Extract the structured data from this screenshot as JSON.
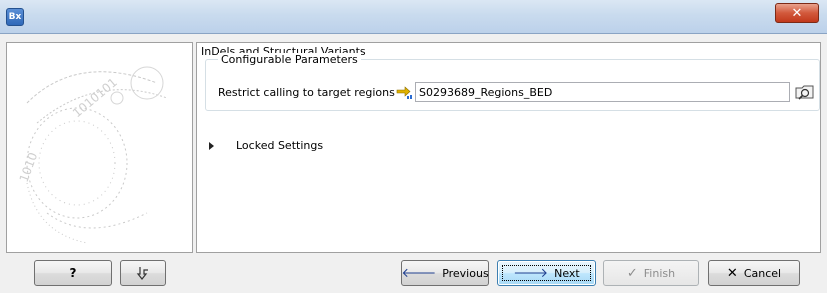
{
  "window": {
    "app_icon_text": "Bx",
    "close_glyph": "✕"
  },
  "section": {
    "title": "InDels and Structural Variants"
  },
  "configurable": {
    "title": "Configurable Parameters",
    "target_label": "Restrict calling to target regions",
    "target_value": "S0293689_Regions_BED"
  },
  "locked": {
    "label": "Locked Settings"
  },
  "buttons": {
    "help": "?",
    "reset_icon": "reset-icon",
    "previous": "Previous",
    "next": "Next",
    "finish": "Finish",
    "cancel": "Cancel"
  },
  "colors": {
    "next_arrow": "#1f3f8f",
    "cancel_x": "#1a1a1a"
  }
}
